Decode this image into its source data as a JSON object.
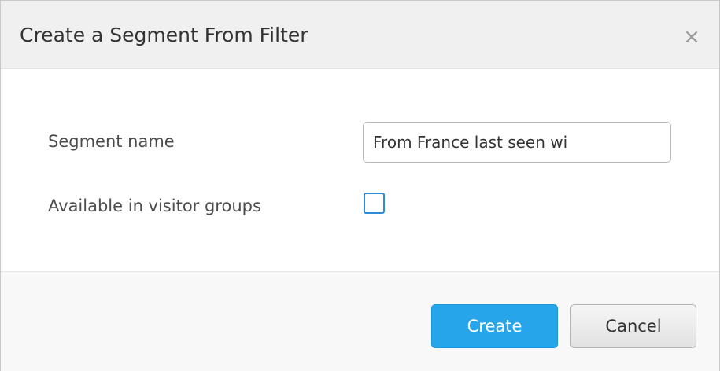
{
  "dialog": {
    "title": "Create a Segment From Filter",
    "close_glyph": "×"
  },
  "form": {
    "segment_name_label": "Segment name",
    "segment_name_value": "From France last seen wi",
    "visitor_groups_label": "Available in visitor groups",
    "visitor_groups_checked": false
  },
  "footer": {
    "create_label": "Create",
    "cancel_label": "Cancel"
  },
  "colors": {
    "primary_button": "#26a5ea",
    "checkbox_border": "#2f8bd6",
    "header_background": "#f0f0f0"
  }
}
